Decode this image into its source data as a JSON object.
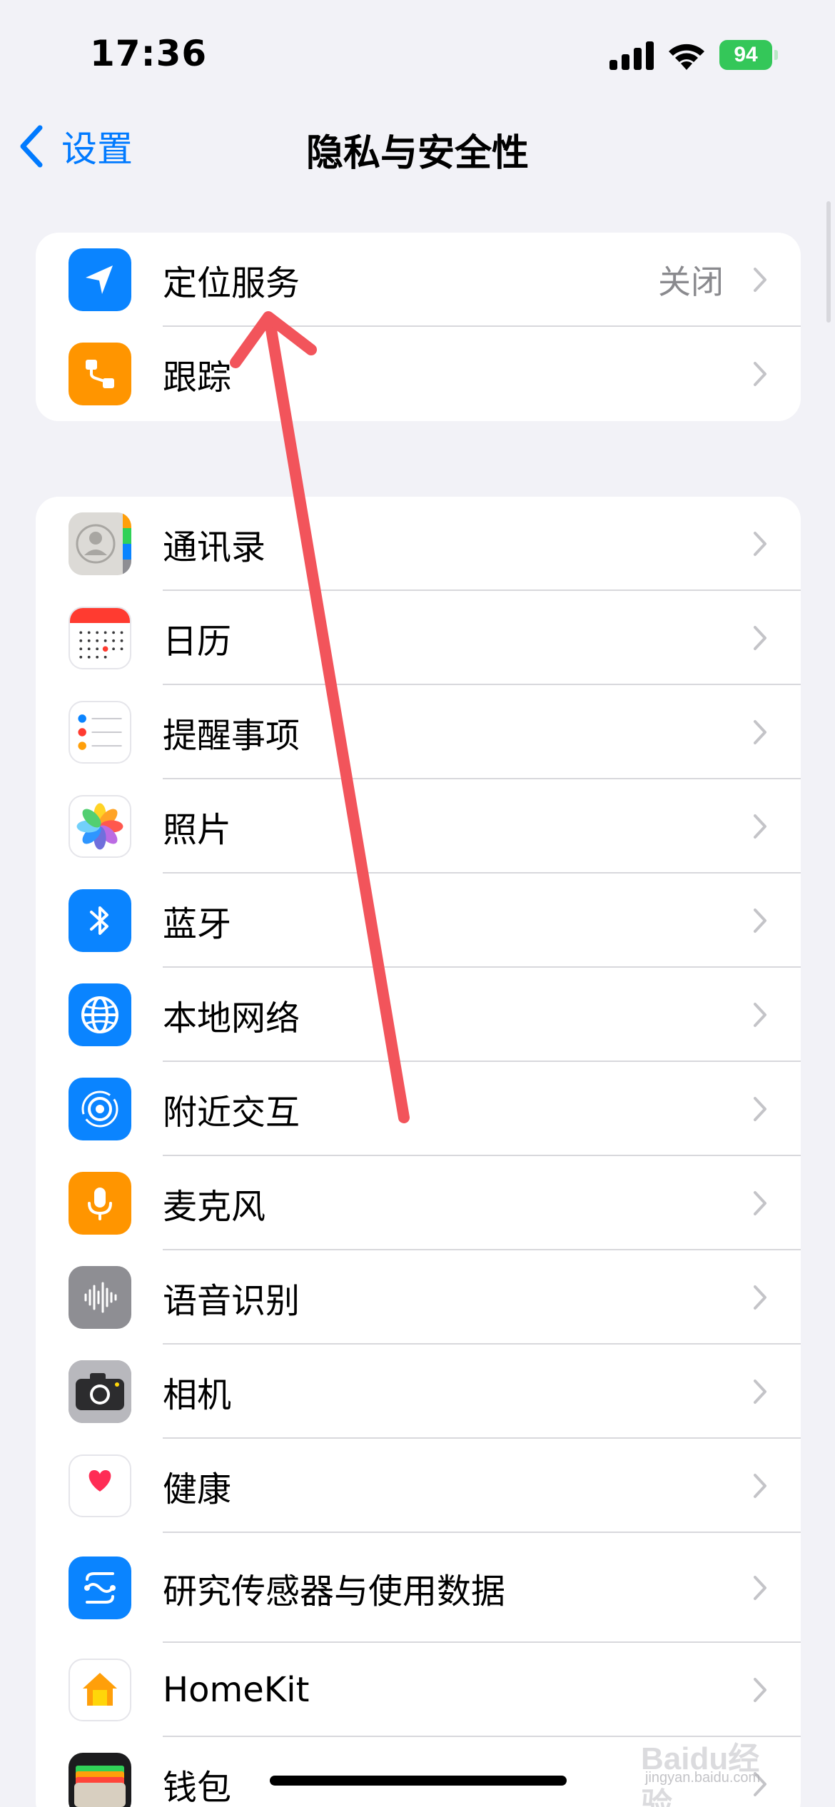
{
  "status_bar": {
    "time": "17:36",
    "battery": "94"
  },
  "nav": {
    "back_label": "设置",
    "title": "隐私与安全性"
  },
  "group1": [
    {
      "name": "location-services",
      "label": "定位服务",
      "value": "关闭",
      "icon": "location-arrow-icon",
      "color": "#0a84ff"
    },
    {
      "name": "tracking",
      "label": "跟踪",
      "value": "",
      "icon": "tracking-icon",
      "color": "#ff9500"
    }
  ],
  "group2": [
    {
      "name": "contacts",
      "label": "通讯录",
      "icon": "contacts-icon"
    },
    {
      "name": "calendars",
      "label": "日历",
      "icon": "calendar-icon"
    },
    {
      "name": "reminders",
      "label": "提醒事项",
      "icon": "reminders-icon"
    },
    {
      "name": "photos",
      "label": "照片",
      "icon": "photos-icon"
    },
    {
      "name": "bluetooth",
      "label": "蓝牙",
      "icon": "bluetooth-icon"
    },
    {
      "name": "local-network",
      "label": "本地网络",
      "icon": "globe-icon"
    },
    {
      "name": "nearby-interactions",
      "label": "附近交互",
      "icon": "nearby-icon"
    },
    {
      "name": "microphone",
      "label": "麦克风",
      "icon": "microphone-icon"
    },
    {
      "name": "speech-recognition",
      "label": "语音识别",
      "icon": "waveform-icon"
    },
    {
      "name": "camera",
      "label": "相机",
      "icon": "camera-icon"
    },
    {
      "name": "health",
      "label": "健康",
      "icon": "heart-icon"
    },
    {
      "name": "research-sensor",
      "label": "研究传感器与使用数据",
      "icon": "research-icon"
    },
    {
      "name": "homekit",
      "label": "HomeKit",
      "icon": "home-icon"
    },
    {
      "name": "wallet",
      "label": "钱包",
      "icon": "wallet-icon"
    }
  ],
  "watermark": {
    "brand": "Baidu经验",
    "sub": "jingyan.baidu.com"
  },
  "colors": {
    "accent": "#007aff",
    "annotation": "#f2545b",
    "background": "#f2f2f7"
  }
}
